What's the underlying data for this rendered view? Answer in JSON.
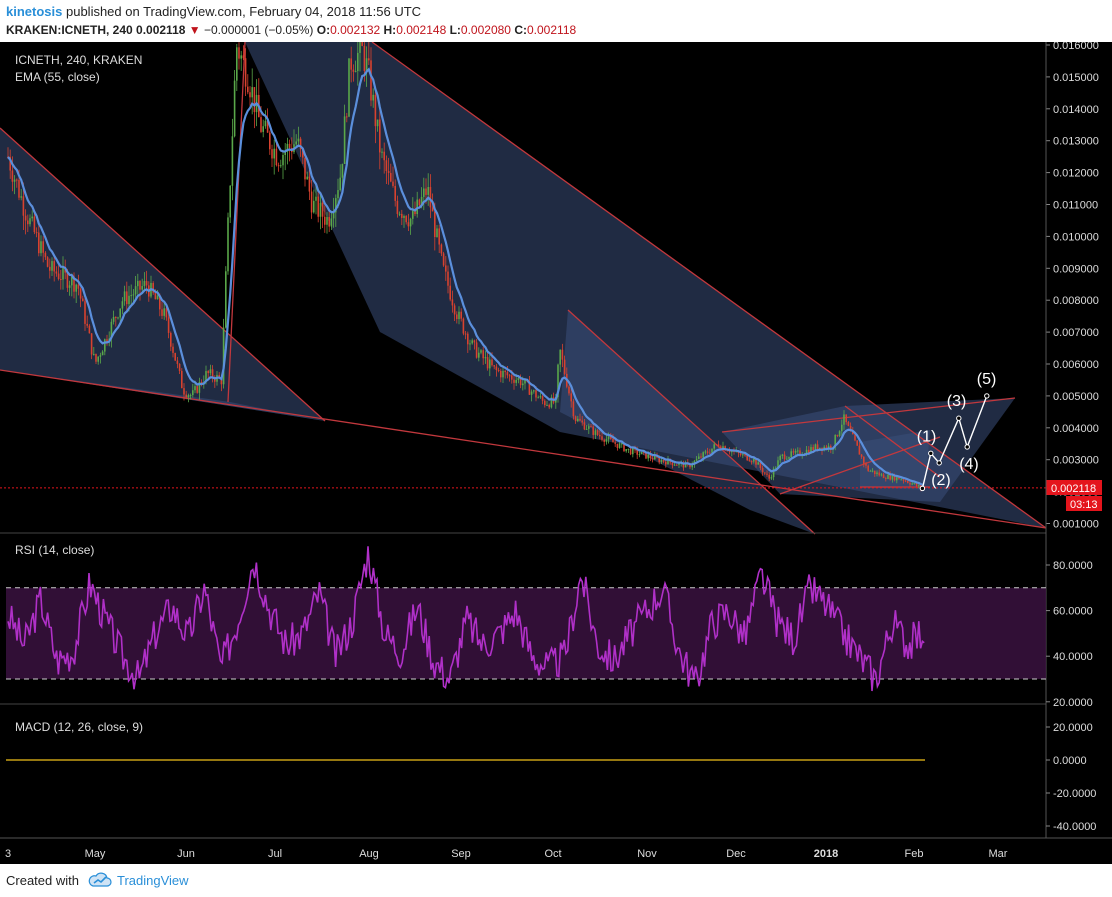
{
  "header": {
    "author": "kinetosis",
    "published_text": "published on TradingView.com, February 04, 2018 11:56 UTC",
    "symbol_line": "KRAKEN:ICNETH, 240",
    "last": "0.002118",
    "change_arrow": "▼",
    "change": "−0.000001 (−0.05%)",
    "o_label": "O:",
    "o_value": "0.002132",
    "h_label": "H:",
    "h_value": "0.002148",
    "l_label": "L:",
    "l_value": "0.002080",
    "c_label": "C:",
    "c_value": "0.002118"
  },
  "panes": {
    "main_title": "ICNETH, 240, KRAKEN",
    "ema_label": "EMA (55, close)",
    "rsi_label": "RSI (14, close)",
    "macd_label": "MACD (12, 26, close, 9)"
  },
  "price_axis": {
    "ticks": [
      "0.016000",
      "0.015000",
      "0.014000",
      "0.013000",
      "0.012000",
      "0.011000",
      "0.010000",
      "0.009000",
      "0.008000",
      "0.007000",
      "0.006000",
      "0.005000",
      "0.004000",
      "0.003000",
      "0.002000",
      "0.001000"
    ],
    "current_price": "0.002118",
    "countdown": "03:13"
  },
  "rsi_axis": {
    "ticks": [
      "80.0000",
      "60.0000",
      "40.0000",
      "20.0000"
    ]
  },
  "macd_axis": {
    "ticks": [
      "20.0000",
      "0.0000",
      "-20.0000",
      "-40.0000"
    ]
  },
  "time_axis": {
    "labels": [
      "3",
      "May",
      "Jun",
      "Jul",
      "Aug",
      "Sep",
      "Oct",
      "Nov",
      "Dec",
      "2018",
      "Feb",
      "Mar"
    ]
  },
  "wave_labels": [
    "(1)",
    "(2)",
    "(3)",
    "(4)",
    "(5)"
  ],
  "footer": {
    "created_with": "Created with",
    "brand": "TradingView"
  },
  "colors": {
    "background": "#000000",
    "pattern_fill": "#3a4f7a",
    "trendline": "#c2383d",
    "ema": "#5b8fdc",
    "candle_up": "#5aa84a",
    "candle_down": "#d8422f",
    "rsi_line": "#b030c8",
    "rsi_band": "#3a1240",
    "macd_line": "#c8a016",
    "price_tag": "#e4141c",
    "brand": "#2a8fd8"
  },
  "chart_data": [
    {
      "type": "candlestick",
      "title": "ICNETH, 240, KRAKEN",
      "x_range": [
        "2018-04-01",
        "2018-03-10"
      ],
      "ylim": [
        0.0005,
        0.0161
      ],
      "price_path": {
        "dates": [
          "Apr 01",
          "Apr 07",
          "Apr 15",
          "Apr 25",
          "May 01",
          "May 10",
          "May 18",
          "May 24",
          "May 30",
          "Jun 03",
          "Jun 08",
          "Jun 13",
          "Jun 15",
          "Jun 18",
          "Jun 22",
          "Jun 26",
          "Jul 02",
          "Jul 08",
          "Jul 13",
          "Jul 18",
          "Jul 22",
          "Jul 25",
          "Jul 29",
          "Aug 01",
          "Aug 05",
          "Aug 10",
          "Aug 15",
          "Aug 20",
          "Aug 25",
          "Aug 30",
          "Sep 05",
          "Sep 12",
          "Sep 20",
          "Sep 28",
          "Oct 02",
          "Oct 03",
          "Oct 08",
          "Oct 15",
          "Oct 25",
          "Nov 05",
          "Nov 15",
          "Nov 25",
          "Dec 01",
          "Dec 07",
          "Dec 12",
          "Dec 16",
          "Dec 22",
          "Dec 28",
          "Jan 03",
          "Jan 07",
          "Jan 11",
          "Jan 15",
          "Jan 20",
          "Jan 27",
          "Feb 04"
        ],
        "close": [
          0.0125,
          0.0108,
          0.009,
          0.0085,
          0.006,
          0.008,
          0.0085,
          0.0075,
          0.0052,
          0.005,
          0.0057,
          0.0055,
          0.01,
          0.016,
          0.015,
          0.0135,
          0.0125,
          0.013,
          0.011,
          0.0105,
          0.012,
          0.0155,
          0.0158,
          0.015,
          0.0125,
          0.011,
          0.0105,
          0.0115,
          0.009,
          0.0075,
          0.0065,
          0.0058,
          0.0055,
          0.0048,
          0.0048,
          0.0065,
          0.0043,
          0.0038,
          0.0033,
          0.003,
          0.0028,
          0.0035,
          0.0032,
          0.003,
          0.0024,
          0.0031,
          0.0032,
          0.0034,
          0.0034,
          0.0043,
          0.0035,
          0.0027,
          0.0025,
          0.0024,
          0.0021
        ]
      },
      "overlay_series": [
        {
          "name": "EMA (55, close)"
        }
      ],
      "projection_waves": {
        "labels": [
          "(1)",
          "(2)",
          "(3)",
          "(4)",
          "(5)"
        ],
        "points": [
          {
            "x": "Feb 04",
            "y": 0.0021
          },
          {
            "x": "Feb 07",
            "y": 0.0032
          },
          {
            "x": "Feb 10",
            "y": 0.0029
          },
          {
            "x": "Feb 17",
            "y": 0.0043
          },
          {
            "x": "Feb 20",
            "y": 0.0034
          },
          {
            "x": "Feb 27",
            "y": 0.005
          }
        ]
      },
      "grid": false
    },
    {
      "type": "line",
      "title": "RSI (14, close)",
      "ylim": [
        15,
        93
      ],
      "bands": [
        30,
        70
      ],
      "series": [
        {
          "values": [
            58,
            45,
            65,
            38,
            42,
            72,
            55,
            40,
            30,
            50,
            62,
            48,
            70,
            35,
            55,
            83,
            60,
            45,
            50,
            68,
            40,
            55,
            86,
            50,
            42,
            62,
            38,
            30,
            56,
            45,
            50,
            60,
            40,
            35,
            40,
            76,
            45,
            38,
            50,
            60,
            70,
            42,
            28,
            55,
            60,
            48,
            76,
            55,
            48,
            70,
            62,
            50,
            40,
            30,
            55,
            45,
            52
          ]
        }
      ]
    },
    {
      "type": "line",
      "title": "MACD (12, 26, close, 9)",
      "ylim": [
        -46,
        25
      ],
      "series": [
        {
          "values": [
            0,
            0
          ]
        }
      ]
    }
  ]
}
